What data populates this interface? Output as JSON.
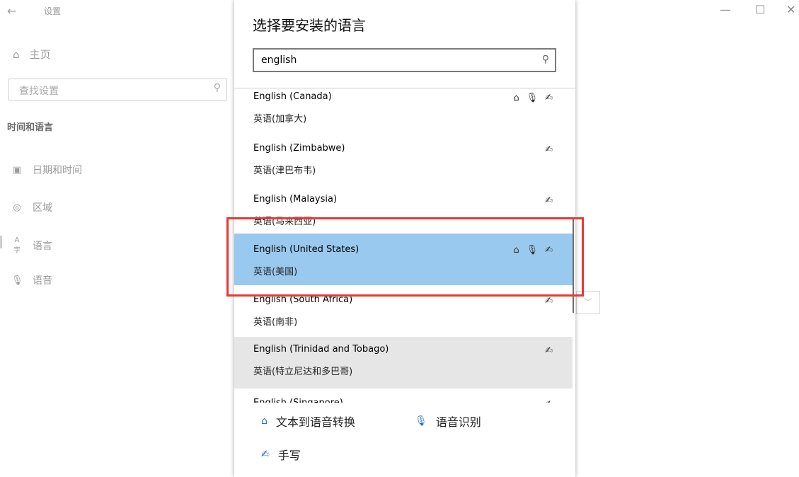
{
  "window": {
    "title": "设置",
    "back_glyph": "←",
    "minimize_glyph": "—",
    "maximize_glyph": "☐",
    "close_glyph": "✕"
  },
  "sidebar": {
    "home_label": "主页",
    "search_placeholder": "查找设置",
    "section_title": "时间和语言",
    "items": [
      {
        "label": "日期和时间",
        "icon": "calendar-clock-icon",
        "glyph": "▣"
      },
      {
        "label": "区域",
        "icon": "globe-icon",
        "glyph": "◎"
      },
      {
        "label": "语言",
        "icon": "language-icon",
        "glyph": "A字"
      },
      {
        "label": "语音",
        "icon": "microphone-icon",
        "glyph": "🎙"
      }
    ]
  },
  "dialog": {
    "title": "选择要安装的语言",
    "search_value": "english",
    "languages": [
      {
        "name": "English (Canada)",
        "native": "英语(加拿大)",
        "features": [
          "tts",
          "speech",
          "handwriting"
        ]
      },
      {
        "name": "English (Zimbabwe)",
        "native": "英语(津巴布韦)",
        "features": [
          "handwriting"
        ]
      },
      {
        "name": "English (Malaysia)",
        "native": "英语(马来西亚)",
        "features": [
          "handwriting"
        ]
      },
      {
        "name": "English (United States)",
        "native": "英语(美国)",
        "features": [
          "tts",
          "speech",
          "handwriting"
        ],
        "selected": true
      },
      {
        "name": "English (South Africa)",
        "native": "英语(南非)",
        "features": [
          "handwriting"
        ]
      },
      {
        "name": "English (Trinidad and Tobago)",
        "native": "英语(特立尼达和多巴哥)",
        "features": [
          "handwriting"
        ]
      },
      {
        "name": "English (Singapore)",
        "native": "",
        "features": [
          "handwriting"
        ]
      }
    ],
    "legend": {
      "tts_label": "文本到语音转换",
      "speech_label": "语音识别",
      "handwriting_label": "手写"
    }
  },
  "icons": {
    "tts_glyph": "⌂",
    "speech_glyph": "🎙",
    "handwriting_glyph": "✍",
    "search_glyph": "⚲",
    "home_glyph": "⌂"
  },
  "colors": {
    "selected_bg": "#99c9ee",
    "hover_bg": "#e6e6e6",
    "highlight_border": "#e53935",
    "icon_blue": "#2a6ec4"
  }
}
